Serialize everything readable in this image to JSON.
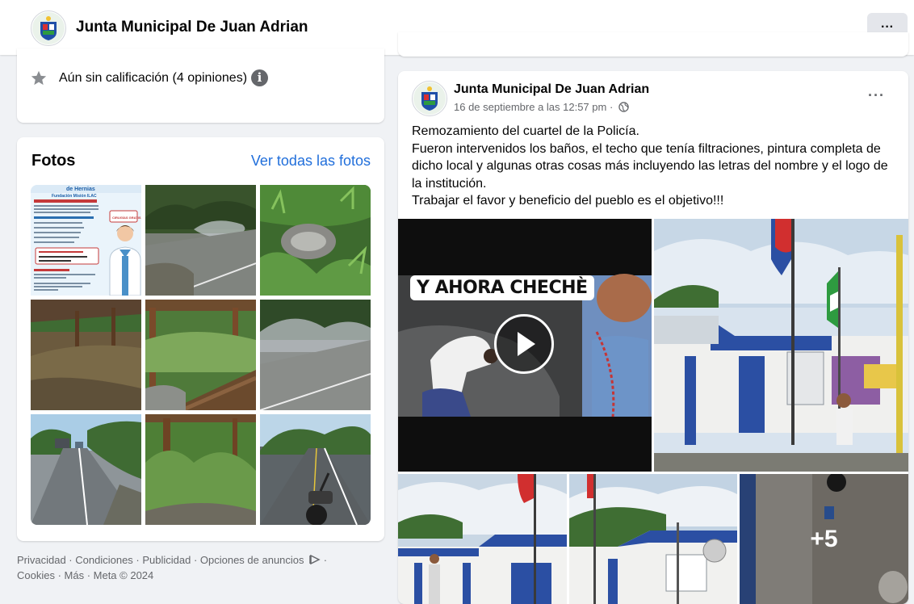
{
  "header": {
    "page_name": "Junta Municipal De Juan Adrian",
    "more_label": "···",
    "avatar_icon": "municipal-seal-icon"
  },
  "rating": {
    "text": "Aún sin calificación (4 opiniones)",
    "info_label": "i",
    "icon": "star-icon"
  },
  "photos": {
    "title": "Fotos",
    "see_all": "Ver todas las fotos",
    "flyer": {
      "heading": "de Hernias",
      "subheading": "Fundación Misión ILAC",
      "badge": "CIRUGÍAS GRATIS"
    }
  },
  "footer": {
    "line1": "Privacidad · Condiciones · Publicidad · Opciones de anuncios",
    "ad_choices_icon": "ad-choices-icon",
    "line1_end": " ·",
    "line2": "Cookies · Más · Meta © 2024"
  },
  "post": {
    "author": "Junta Municipal De Juan Adrian",
    "timestamp": "16 de septiembre a las 12:57 pm",
    "separator": " · ",
    "audience_icon": "globe-icon",
    "more_label": "···",
    "lines": [
      "Remozamiento del cuartel de la Policía.",
      "Fueron intervenidos los baños, el techo que tenía filtraciones, pintura completa de dicho local y algunas otras cosas más incluyendo las letras del nombre y el logo de la institución.",
      "Trabajar el favor y beneficio del pueblo es el objetivo!!!"
    ],
    "video_caption": "Y AHORA CHECHÈ",
    "more_photos": "+5"
  }
}
